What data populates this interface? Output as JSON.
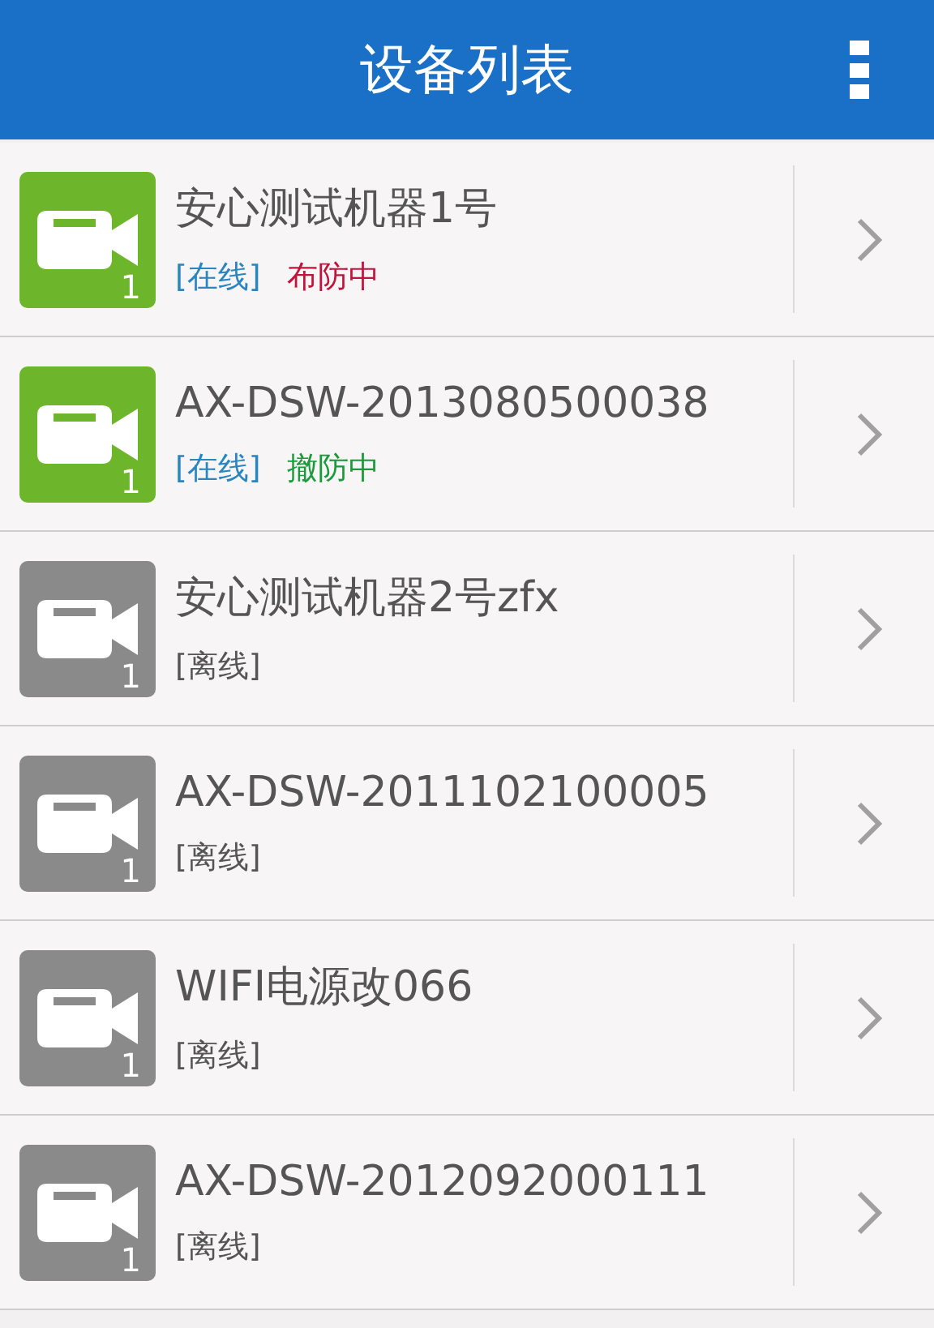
{
  "header": {
    "title": "设备列表"
  },
  "devices": [
    {
      "name": "安心测试机器1号",
      "online": true,
      "status_text": "[在线]",
      "channel": "1",
      "arm": {
        "kind": "armed",
        "label": "布防中"
      }
    },
    {
      "name": "AX-DSW-2013080500038",
      "online": true,
      "status_text": "[在线]",
      "channel": "1",
      "arm": {
        "kind": "disarmed",
        "label": "撤防中"
      }
    },
    {
      "name": "安心测试机器2号zfx",
      "online": false,
      "status_text": "[离线]",
      "channel": "1"
    },
    {
      "name": "AX-DSW-2011102100005",
      "online": false,
      "status_text": "[离线]",
      "channel": "1"
    },
    {
      "name": "WIFI电源改066",
      "online": false,
      "status_text": "[离线]",
      "channel": "1"
    },
    {
      "name": "AX-DSW-2012092000111",
      "online": false,
      "status_text": "[离线]",
      "channel": "1"
    }
  ]
}
